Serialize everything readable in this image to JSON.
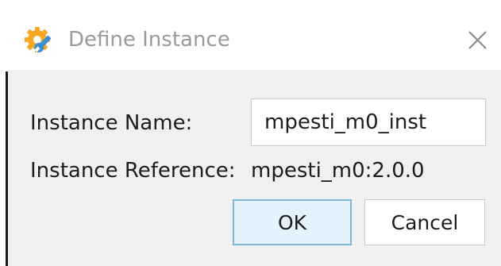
{
  "window": {
    "title": "Define Instance",
    "icon": "gear-wrench-icon",
    "close_glyph": "✕"
  },
  "form": {
    "instance_name_label": "Instance Name:",
    "instance_name_value": "mpesti_m0_inst",
    "instance_reference_label": "Instance Reference:",
    "instance_reference_value": "mpesti_m0:2.0.0"
  },
  "buttons": {
    "ok_label": "OK",
    "cancel_label": "Cancel"
  },
  "colors": {
    "icon_gear": "#f5a623",
    "icon_wrench": "#3b8fd6",
    "ok_border": "#7fb6e0",
    "ok_fill": "#e5f1fb",
    "body_background": "#f0f0f0"
  }
}
